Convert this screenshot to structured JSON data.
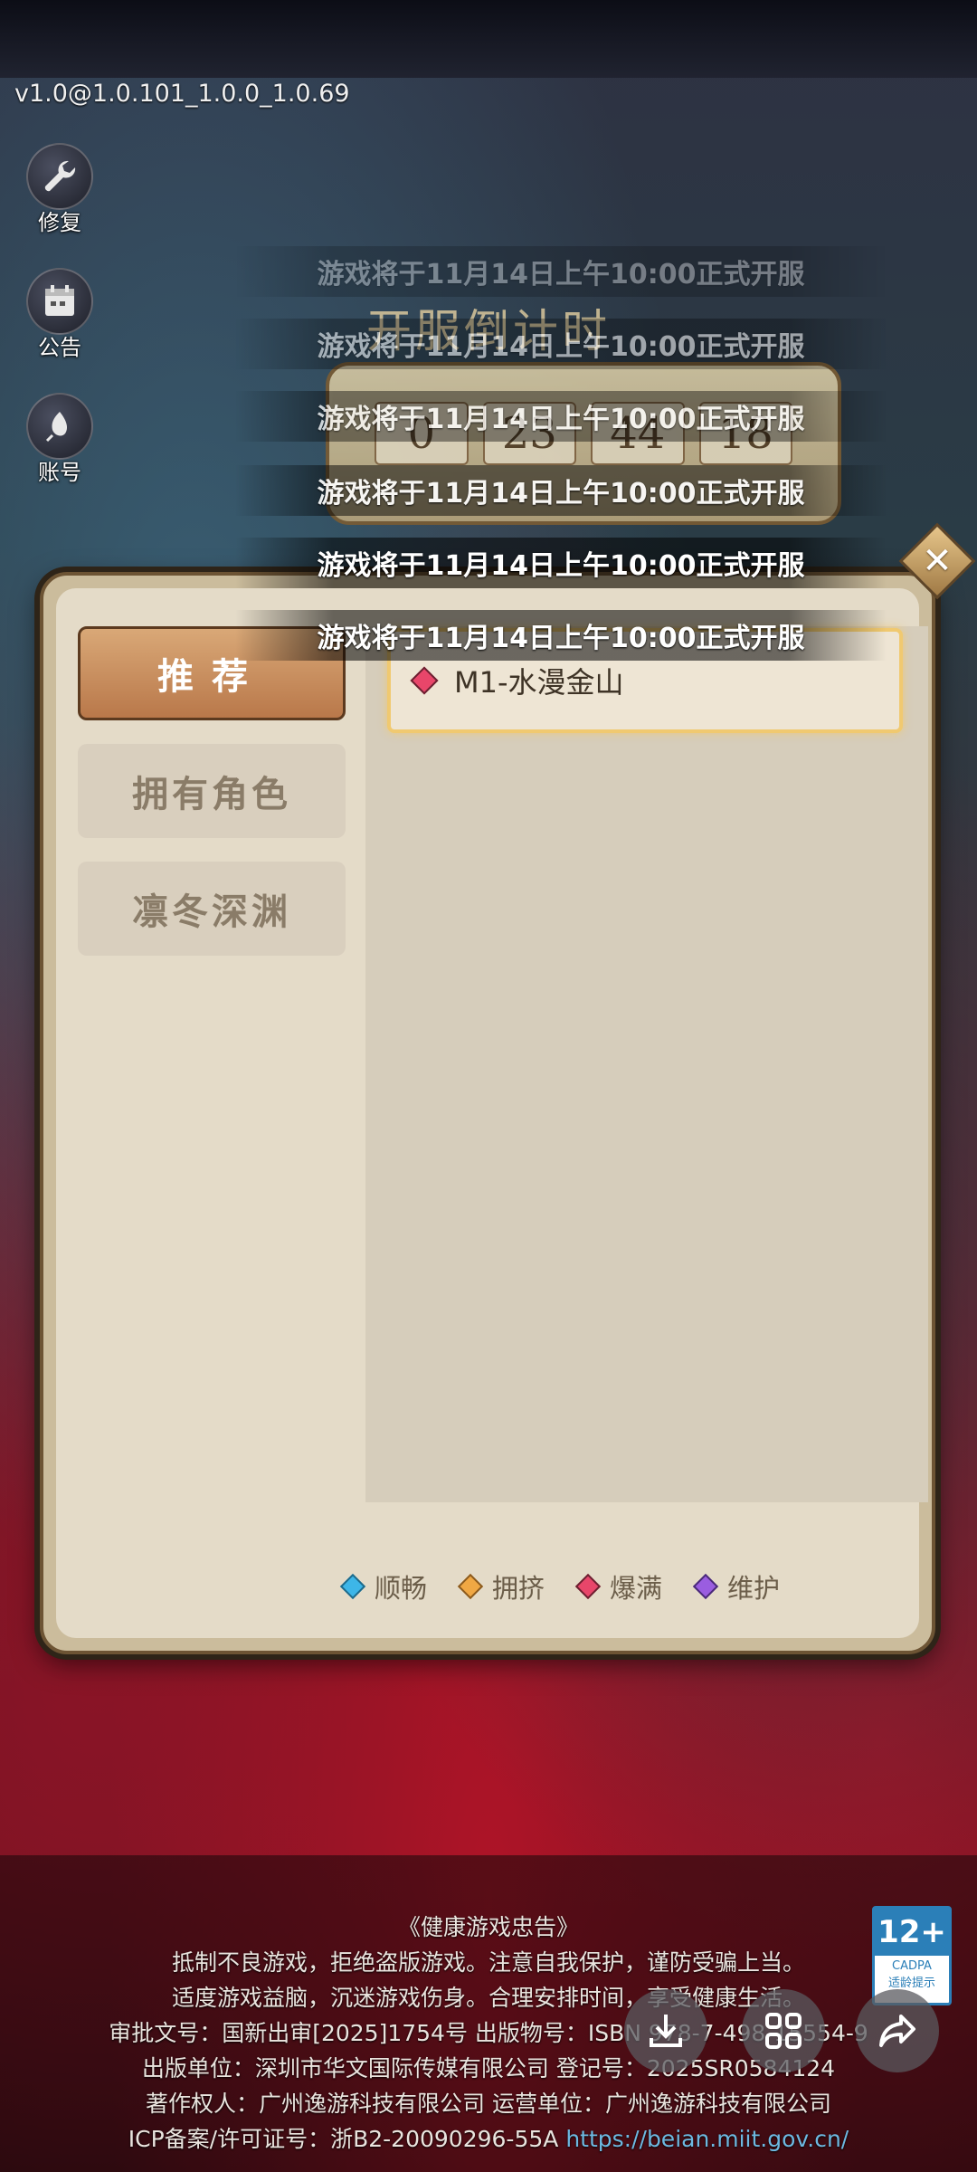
{
  "version": "v1.0@1.0.101_1.0.0_1.0.69",
  "side_buttons": [
    {
      "label": "修复",
      "icon": "wrench-icon"
    },
    {
      "label": "公告",
      "icon": "calendar-icon"
    },
    {
      "label": "账号",
      "icon": "account-icon"
    }
  ],
  "countdown": {
    "title": "开服倒计时",
    "digits": [
      "0",
      "23",
      "44",
      "18"
    ]
  },
  "toasts": [
    "游戏将于11月14日上午10:00正式开服",
    "游戏将于11月14日上午10:00正式开服",
    "游戏将于11月14日上午10:00正式开服",
    "游戏将于11月14日上午10:00正式开服",
    "游戏将于11月14日上午10:00正式开服",
    "游戏将于11月14日上午10:00正式开服"
  ],
  "dialog": {
    "tabs": [
      {
        "label": "推荐",
        "active": true
      },
      {
        "label": "拥有角色",
        "active": false
      },
      {
        "label": "凛冬深渊",
        "active": false
      }
    ],
    "servers": [
      {
        "name": "M1-水漫金山",
        "status": "爆满"
      }
    ],
    "legend": [
      {
        "label": "顺畅",
        "color": "#3db6e8"
      },
      {
        "label": "拥挤",
        "color": "#f0a844"
      },
      {
        "label": "爆满",
        "color": "#e8466a"
      },
      {
        "label": "维护",
        "color": "#9a5de0"
      }
    ],
    "close_glyph": "✕"
  },
  "footer": {
    "lines": [
      "《健康游戏忠告》",
      "抵制不良游戏，拒绝盗版游戏。注意自我保护，谨防受骗上当。",
      "适度游戏益脑，沉迷游戏伤身。合理安排时间，享受健康生活。",
      "审批文号：国新出审[2025]1754号 出版物号：ISBN 978-7-498-15554-9",
      "出版单位：深圳市华文国际传媒有限公司 登记号：2025SR0584124",
      "著作权人：广州逸游科技有限公司 运营单位：广州逸游科技有限公司"
    ],
    "icp_prefix": "ICP备案/许可证号：浙B2-20090296-55A",
    "icp_link": "https://beian.miit.gov.cn/",
    "age_rating": "12+",
    "age_org": "CADPA",
    "age_note": "适龄提示"
  },
  "floating_actions": [
    {
      "icon": "download-icon"
    },
    {
      "icon": "grid-icon"
    },
    {
      "icon": "share-icon"
    }
  ]
}
